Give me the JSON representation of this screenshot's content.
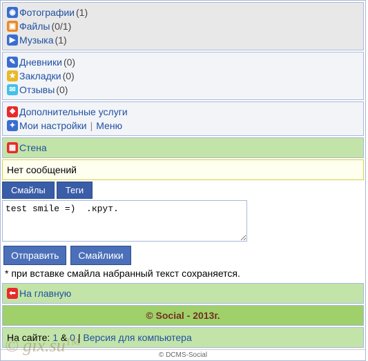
{
  "media": {
    "photos": {
      "label": "Фотографии",
      "count": "(1)"
    },
    "files": {
      "label": "Файлы",
      "count": "(0/1)"
    },
    "music": {
      "label": "Музыка",
      "count": "(1)"
    }
  },
  "activity": {
    "diaries": {
      "label": "Дневники",
      "count": "(0)"
    },
    "bookmarks": {
      "label": "Закладки",
      "count": "(0)"
    },
    "reviews": {
      "label": "Отзывы",
      "count": "(0)"
    }
  },
  "settings": {
    "extra": "Дополнительные услуги",
    "my": "Мои настройки",
    "menu": "Меню"
  },
  "wall": {
    "title": "Стена",
    "empty": "Нет сообщений"
  },
  "tabs": {
    "smiles": "Смайлы",
    "tags": "Теги"
  },
  "textarea": "test smile =)  .крут.",
  "buttons": {
    "send": "Отправить",
    "smilies": "Смайлики"
  },
  "note": "* при вставке смайла набранный текст сохраняется.",
  "home": "На главную",
  "copyright": "© Social - 2013г.",
  "footer": {
    "onsite": "На сайте: ",
    "one": "1",
    "amp": " & ",
    "zero": "0",
    "sep": " | ",
    "pc": "Версия для компьютера"
  },
  "tiny": "© DCMS-Social",
  "watermark": {
    "a": "© gix.su",
    "b": "TM"
  }
}
